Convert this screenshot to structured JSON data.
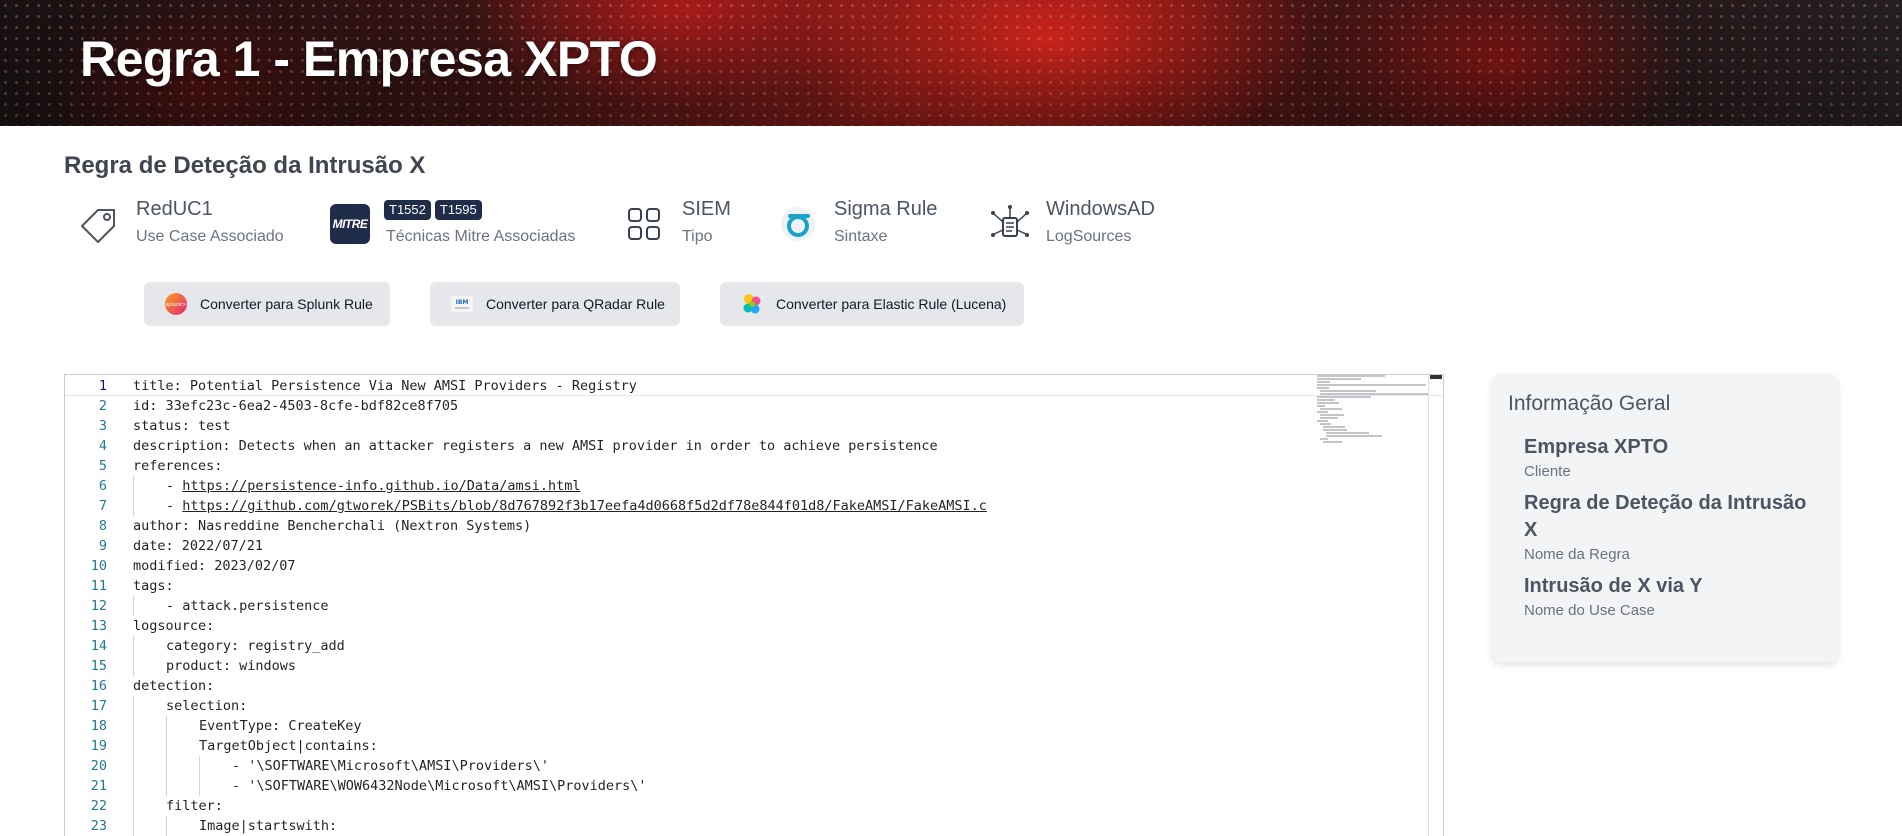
{
  "header": {
    "title": "Regra 1 - Empresa XPTO"
  },
  "rule_name": "Regra de Deteção da Intrusão X",
  "attributes": [
    {
      "value": "RedUC1",
      "label": "Use Case Associado",
      "icon": "tag-icon"
    },
    {
      "value": "",
      "label": "Técnicas Mitre Associadas",
      "icon": "mitre-logo",
      "logo_text": "MITRE",
      "badges": [
        "T1552",
        "T1595"
      ]
    },
    {
      "value": "SIEM",
      "label": "Tipo",
      "icon": "grid-icon"
    },
    {
      "value": "Sigma Rule",
      "label": "Sintaxe",
      "icon": "sigma-logo"
    },
    {
      "value": "WindowsAD",
      "label": "LogSources",
      "icon": "log-sources-icon"
    }
  ],
  "buttons": {
    "splunk": "Converter para Splunk Rule",
    "qradar": "Converter para QRadar Rule",
    "elastic": "Converter para Elastic Rule (Lucena)"
  },
  "button_logo_text": {
    "splunk": "splunk>",
    "qradar": "IBM"
  },
  "code_lines": [
    {
      "n": "1",
      "indent": 0,
      "text": "title: Potential Persistence Via New AMSI Providers - Registry"
    },
    {
      "n": "2",
      "indent": 0,
      "text": "id: 33efc23c-6ea2-4503-8cfe-bdf82ce8f705"
    },
    {
      "n": "3",
      "indent": 0,
      "text": "status: test"
    },
    {
      "n": "4",
      "indent": 0,
      "text": "description: Detects when an attacker registers a new AMSI provider in order to achieve persistence"
    },
    {
      "n": "5",
      "indent": 0,
      "text": "references:"
    },
    {
      "n": "6",
      "indent": 1,
      "prefix": "- ",
      "link": "https://persistence-info.github.io/Data/amsi.html"
    },
    {
      "n": "7",
      "indent": 1,
      "prefix": "- ",
      "link": "https://github.com/gtworek/PSBits/blob/8d767892f3b17eefa4d0668f5d2df78e844f01d8/FakeAMSI/FakeAMSI.c"
    },
    {
      "n": "8",
      "indent": 0,
      "text": "author: Nasreddine Bencherchali (Nextron Systems)"
    },
    {
      "n": "9",
      "indent": 0,
      "text": "date: 2022/07/21"
    },
    {
      "n": "10",
      "indent": 0,
      "text": "modified: 2023/02/07"
    },
    {
      "n": "11",
      "indent": 0,
      "text": "tags:"
    },
    {
      "n": "12",
      "indent": 1,
      "text": "- attack.persistence"
    },
    {
      "n": "13",
      "indent": 0,
      "text": "logsource:"
    },
    {
      "n": "14",
      "indent": 1,
      "text": "category: registry_add"
    },
    {
      "n": "15",
      "indent": 1,
      "text": "product: windows"
    },
    {
      "n": "16",
      "indent": 0,
      "text": "detection:"
    },
    {
      "n": "17",
      "indent": 1,
      "text": "selection:"
    },
    {
      "n": "18",
      "indent": 2,
      "text": "EventType: CreateKey"
    },
    {
      "n": "19",
      "indent": 2,
      "text": "TargetObject|contains:"
    },
    {
      "n": "20",
      "indent": 3,
      "text": "- '\\SOFTWARE\\Microsoft\\AMSI\\Providers\\'"
    },
    {
      "n": "21",
      "indent": 3,
      "text": "- '\\SOFTWARE\\WOW6432Node\\Microsoft\\AMSI\\Providers\\'"
    },
    {
      "n": "22",
      "indent": 1,
      "text": "filter:"
    },
    {
      "n": "23",
      "indent": 2,
      "text": "Image|startswith:"
    }
  ],
  "info": {
    "title": "Informação Geral",
    "items": [
      {
        "value": "Empresa XPTO",
        "label": "Cliente"
      },
      {
        "value": "Regra de Deteção da Intrusão X",
        "label": "Nome da Regra"
      },
      {
        "value": "Intrusão de X via Y",
        "label": "Nome do Use Case"
      }
    ]
  }
}
